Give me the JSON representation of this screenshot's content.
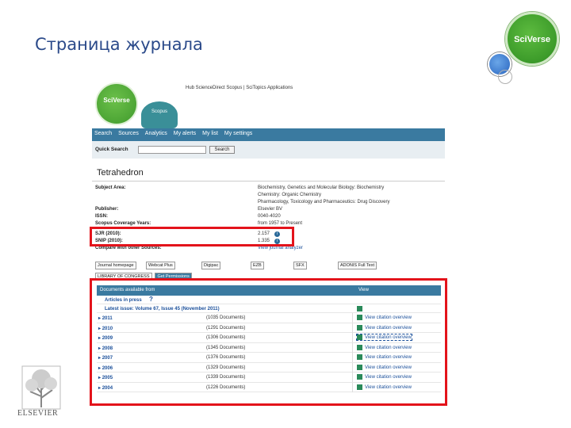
{
  "slide": {
    "title": "Страница журнала"
  },
  "brand": {
    "sciverse": "SciVerse",
    "elsevier": "ELSEVIER"
  },
  "screenshot": {
    "logo": "SciVerse",
    "scopus_tab": "Scopus",
    "top_links": "Hub   ScienceDirect   Scopus  |  SciTopics   Applications",
    "nav": [
      "Search",
      "Sources",
      "Analytics",
      "My alerts",
      "My list",
      "My settings"
    ],
    "quick_search": {
      "label": "Quick Search",
      "button": "Search"
    },
    "journal_title": "Tetrahedron",
    "info_rows": [
      {
        "key": "Subject Area:",
        "value": "Biochemistry, Genetics and Molecular Biology: Biochemistry"
      },
      {
        "key": "",
        "value": "Chemistry: Organic Chemistry"
      },
      {
        "key": "",
        "value": "Pharmacology, Toxicology and Pharmaceutics: Drug Discovery"
      },
      {
        "key": "Publisher:",
        "value": "Elsevier BV"
      },
      {
        "key": "ISSN:",
        "value": "0040-4020"
      },
      {
        "key": "Scopus Coverage Years:",
        "value": "from 1957 to Present"
      },
      {
        "key": "SJR (2010):",
        "value": "2.157"
      },
      {
        "key": "SNIP (2010):",
        "value": "1.335"
      },
      {
        "key": "Compare with other Sources:",
        "value": "View journal analyzer"
      }
    ],
    "badges": [
      "Journal homepage",
      "Webcat Plus",
      "Digipac",
      "EZB",
      "SFX",
      "ADONIS Full Text"
    ],
    "badges_row2": [
      "LIBRARY OF CONGRESS",
      "Get Permissions"
    ],
    "docs": {
      "header_left": "Documents available from",
      "header_right": "View",
      "articles_in_press": "Articles in press",
      "latest_issue": "Latest issue: Volume 67, Issue 45 (November 2011)",
      "rows": [
        {
          "year": "2011",
          "count": "(1035 Documents)",
          "view": "View citation overview"
        },
        {
          "year": "2010",
          "count": "(1291 Documents)",
          "view": "View citation overview"
        },
        {
          "year": "2009",
          "count": "(1306 Documents)",
          "view": "View citation overview"
        },
        {
          "year": "2008",
          "count": "(1345 Documents)",
          "view": "View citation overview"
        },
        {
          "year": "2007",
          "count": "(1376 Documents)",
          "view": "View citation overview"
        },
        {
          "year": "2006",
          "count": "(1329 Documents)",
          "view": "View citation overview"
        },
        {
          "year": "2005",
          "count": "(1339 Documents)",
          "view": "View citation overview"
        },
        {
          "year": "2004",
          "count": "(1226 Documents)",
          "view": "View citation overview"
        }
      ]
    }
  },
  "colors": {
    "title": "#2b4a8a",
    "highlight": "#e3131b",
    "nav": "#3a7aa0",
    "sciverse_green": "#3c9b2a"
  }
}
